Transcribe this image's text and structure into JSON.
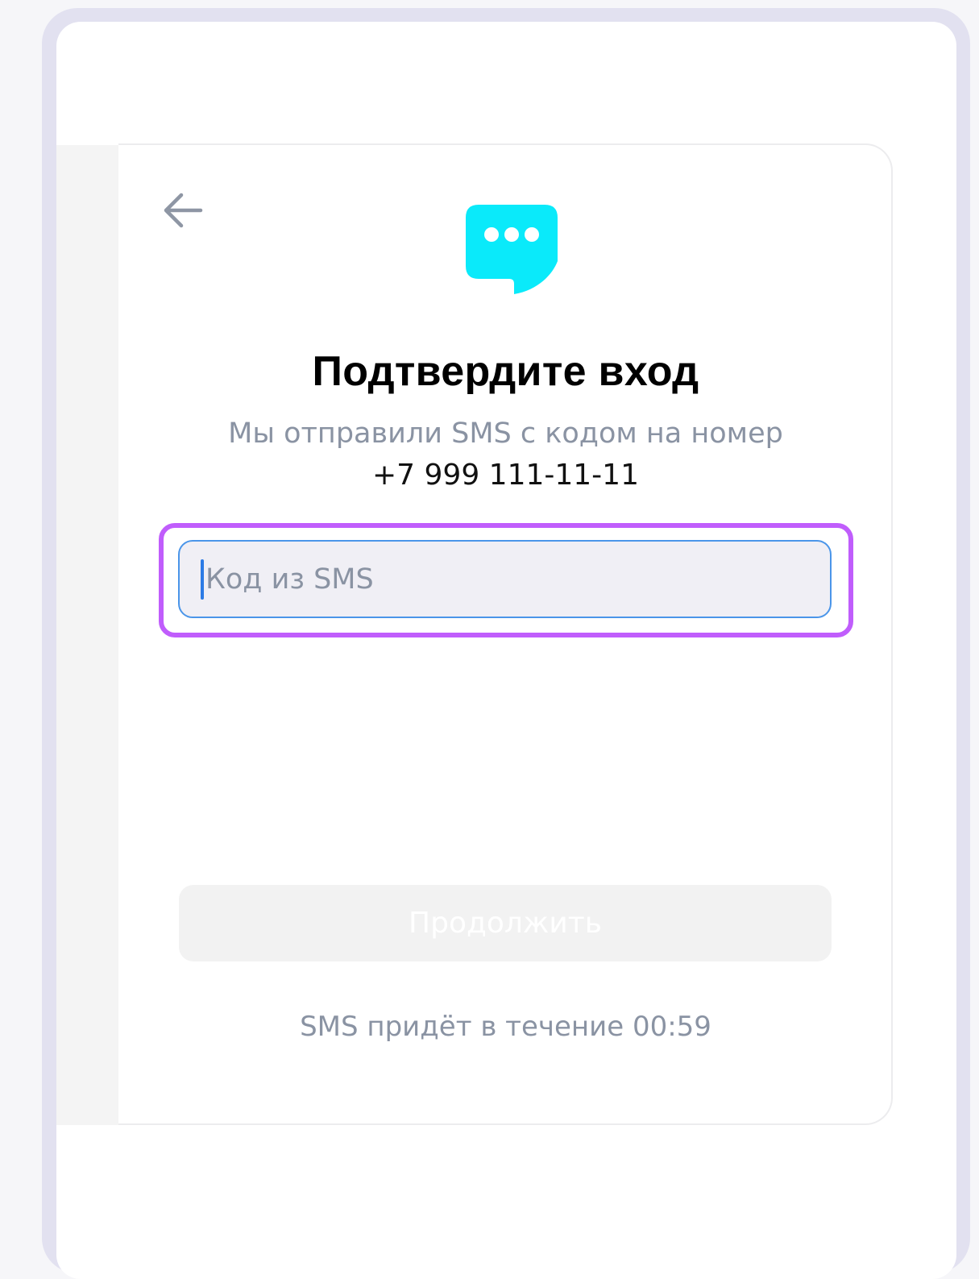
{
  "login": {
    "title": "Подтвердите вход",
    "subtitle": "Мы отправили SMS с кодом на номер",
    "phone": "+7 999 111-11-11",
    "code_input": {
      "value": "",
      "placeholder": "Код из SMS"
    },
    "continue_label": "Продолжить",
    "timer_text": "SMS придёт в течение 00:59"
  },
  "icons": {
    "back": "arrow-left-icon",
    "logo": "chat-bubble-logo"
  },
  "colors": {
    "logo_accent": "#0aeafa",
    "focus_ring": "#c05dfc",
    "input_border": "#4a95e9",
    "muted_text": "#8a93a3",
    "disabled_button_bg": "#f2f2f2"
  }
}
